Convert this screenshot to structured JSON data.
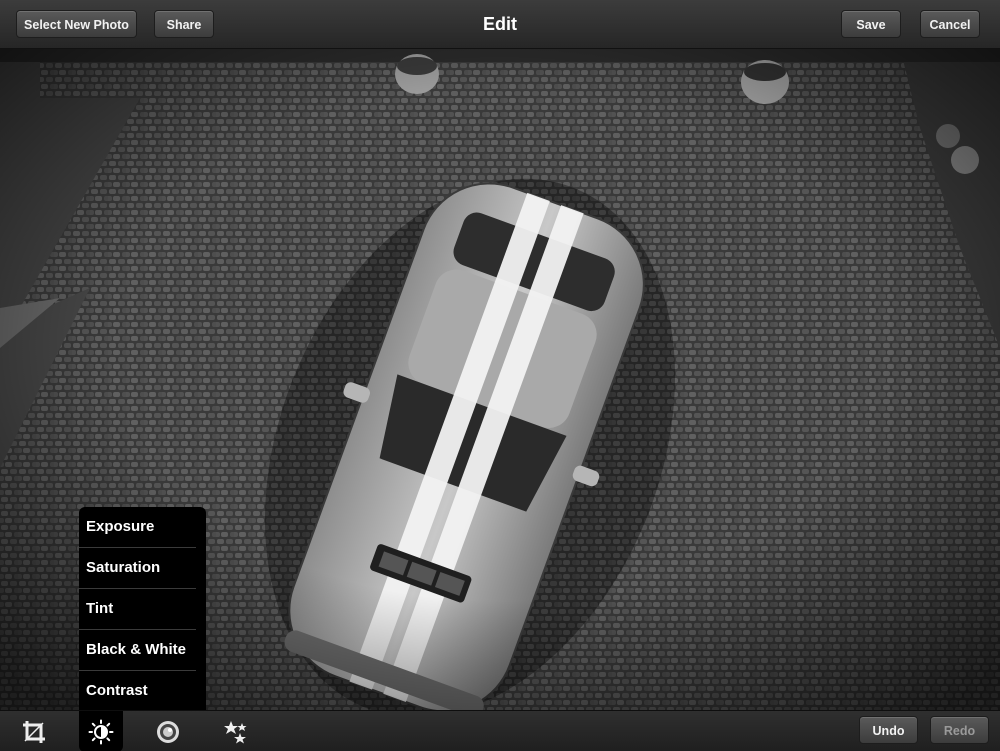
{
  "header": {
    "title": "Edit",
    "select_photo_label": "Select New Photo",
    "share_label": "Share",
    "save_label": "Save",
    "cancel_label": "Cancel"
  },
  "adjust_menu": {
    "items": [
      {
        "label": "Exposure"
      },
      {
        "label": "Saturation"
      },
      {
        "label": "Tint"
      },
      {
        "label": "Black & White"
      },
      {
        "label": "Contrast"
      }
    ]
  },
  "toolbar": {
    "tools": [
      {
        "icon": "crop-icon"
      },
      {
        "icon": "brightness-icon",
        "active": true
      },
      {
        "icon": "filter-icon"
      },
      {
        "icon": "effects-stars-icon"
      }
    ],
    "undo_label": "Undo",
    "redo_label": "Redo"
  },
  "photo": {
    "subject": "black and white photo of a car with racing stripes on a cobblestone courtyard"
  },
  "colors": {
    "bar_background": "#2e2e2e",
    "menu_background": "#000000",
    "text": "#ffffff"
  }
}
